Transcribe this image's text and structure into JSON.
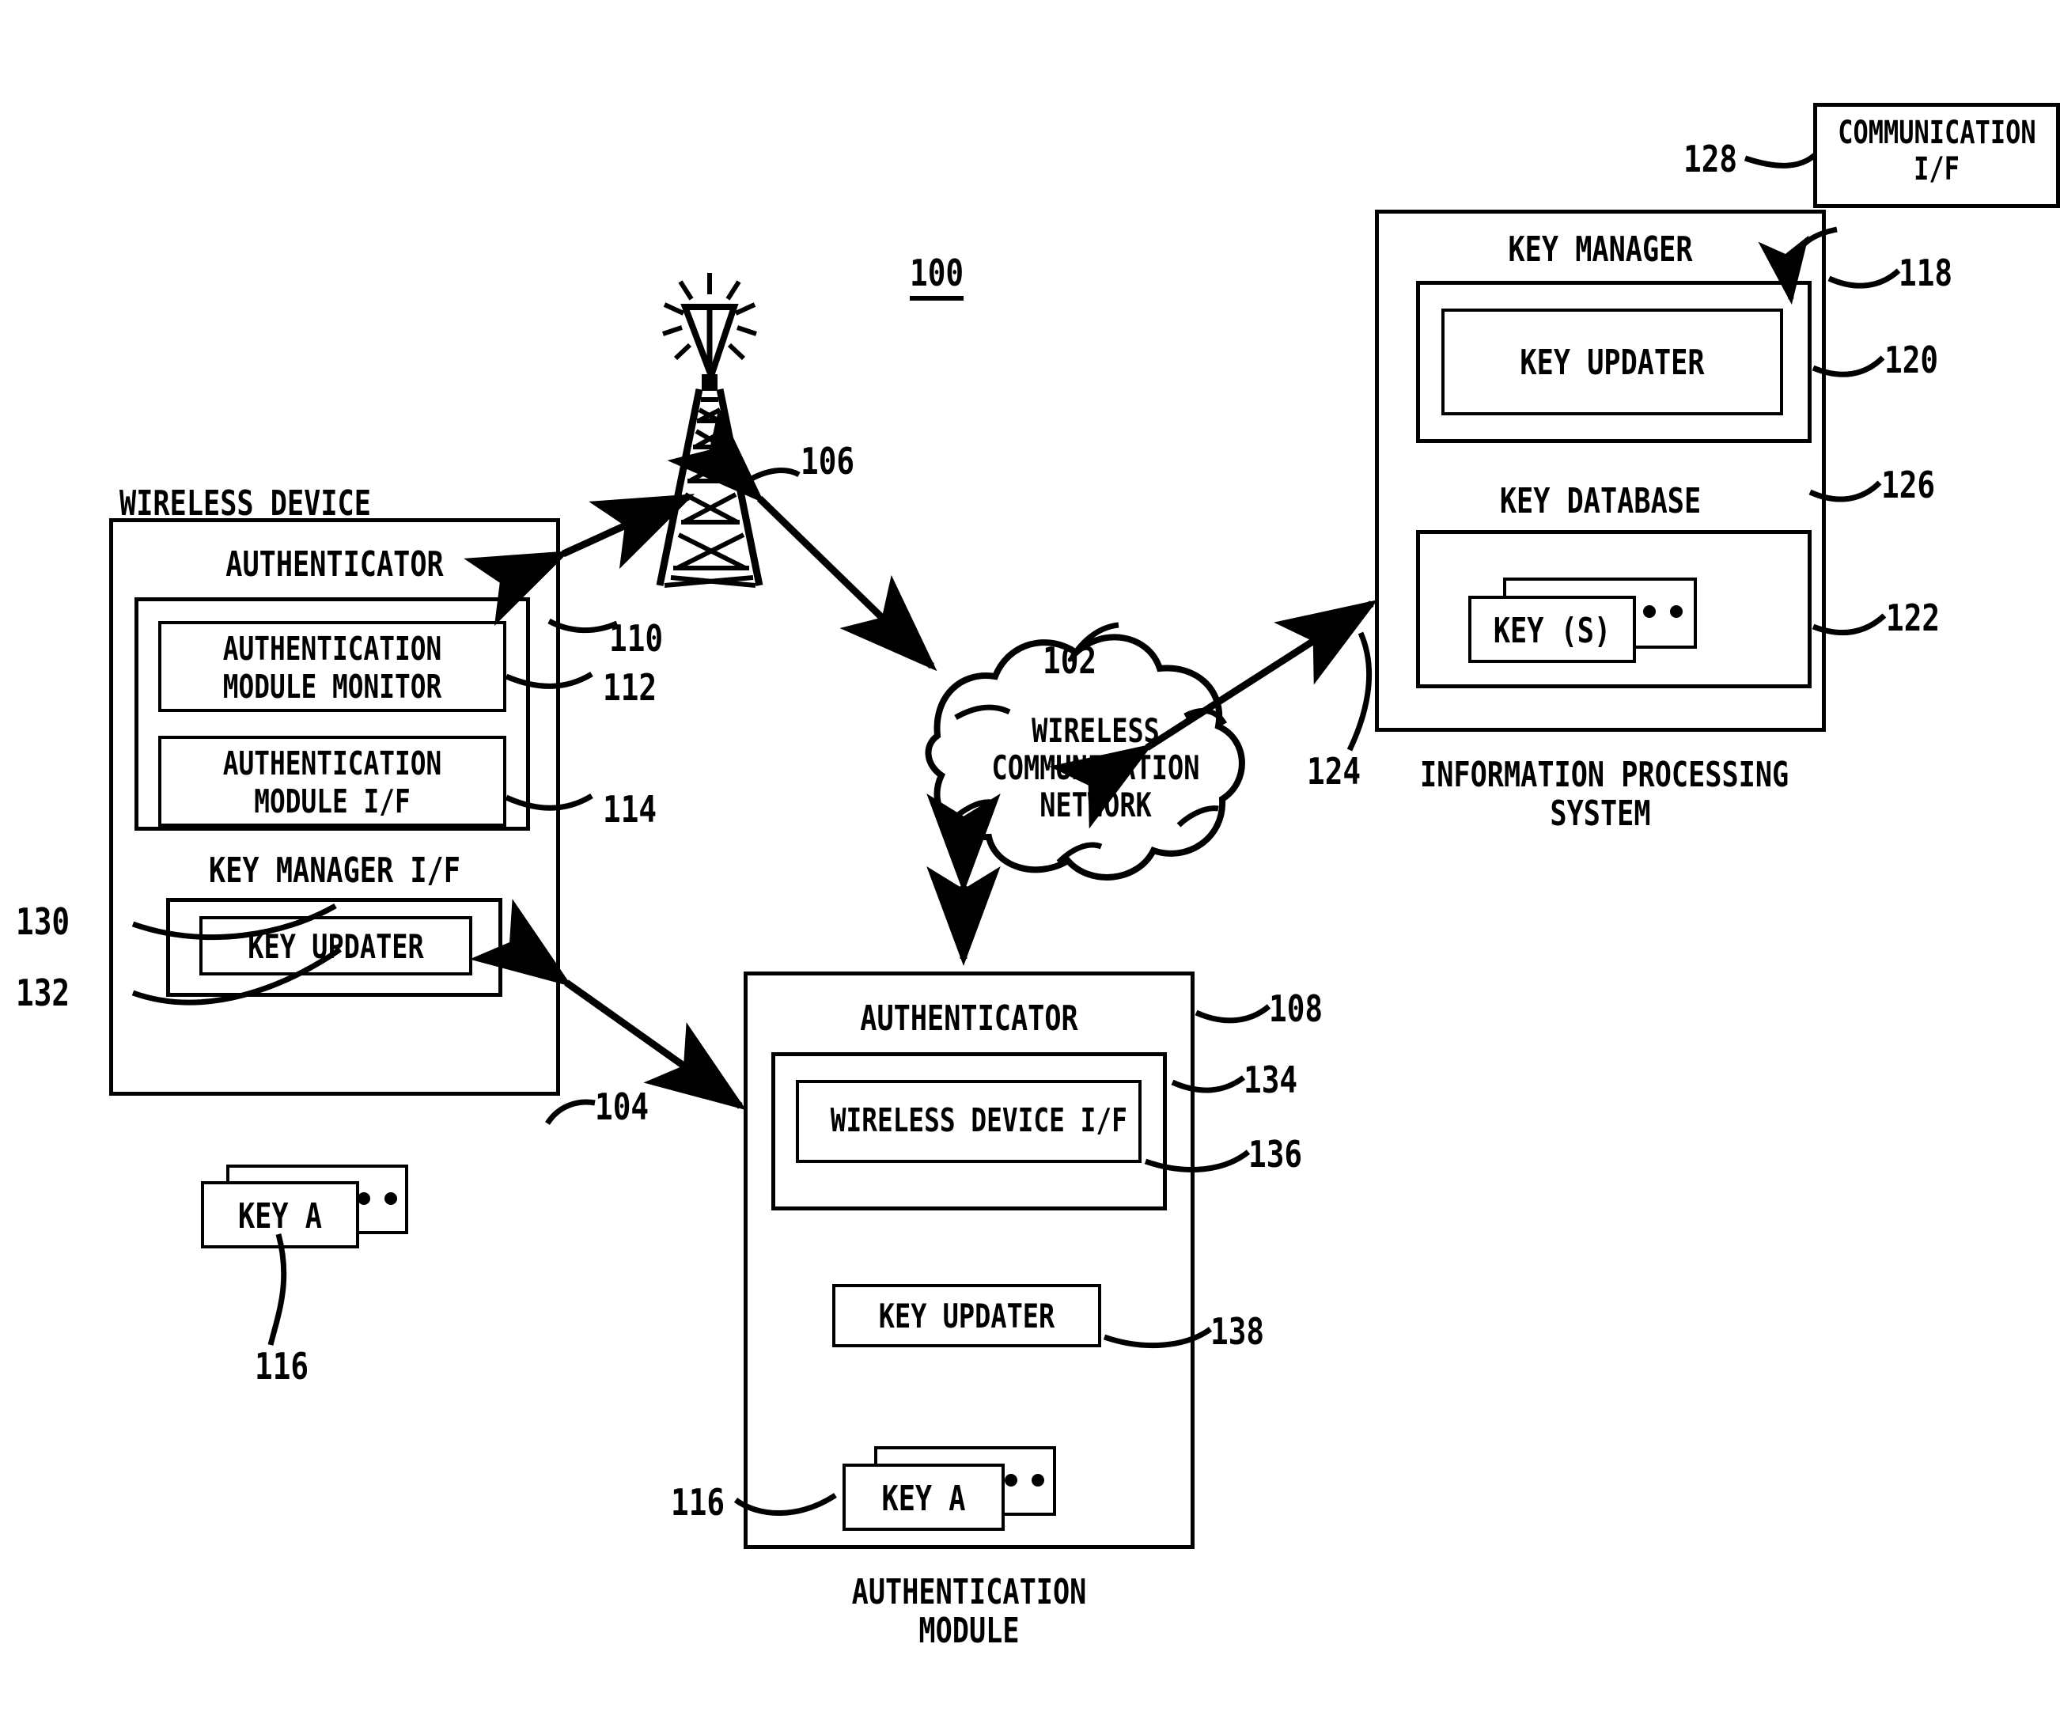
{
  "figure": {
    "number": "100"
  },
  "wireless_device": {
    "title": "WIRELESS DEVICE",
    "ref": "104",
    "authenticator": {
      "title": "AUTHENTICATOR",
      "ref": "110",
      "inner_ref": "112",
      "modules": [
        {
          "label": "AUTHENTICATION\nMODULE MONITOR",
          "ref": "112"
        },
        {
          "label": "AUTHENTICATION\nMODULE I/F",
          "ref": "114"
        }
      ]
    },
    "key_manager_if": {
      "title": "KEY MANAGER I/F",
      "ref": "130",
      "key_updater": {
        "label": "KEY UPDATER",
        "ref": "132"
      }
    },
    "keys": {
      "label": "KEY A",
      "ref": "116",
      "ellipsis": "• • •"
    }
  },
  "tower": {
    "ref": "106"
  },
  "network": {
    "label": "WIRELESS\nCOMMUNICATION\nNETWORK",
    "ref": "102"
  },
  "authentication_module": {
    "title": "AUTHENTICATION\nMODULE",
    "ref": "108",
    "authenticator": {
      "title": "AUTHENTICATOR",
      "ref": "134",
      "wireless_device_if": {
        "label": "WIRELESS DEVICE I/F",
        "ref": "136"
      }
    },
    "key_updater": {
      "label": "KEY UPDATER",
      "ref": "138"
    },
    "keys": {
      "label": "KEY A",
      "ref": "116",
      "ellipsis": "• • •"
    }
  },
  "information_processing_system": {
    "title": "INFORMATION PROCESSING\nSYSTEM",
    "ref": "118",
    "communication_if": {
      "label": "COMMUNICATION\nI/F",
      "ref": "128"
    },
    "key_manager": {
      "title": "KEY MANAGER",
      "ref": "120",
      "key_updater": {
        "label": "KEY UPDATER"
      }
    },
    "key_database": {
      "title": "KEY DATABASE",
      "ref": "126",
      "keys": {
        "label": "KEY (S)",
        "ref": "122",
        "ellipsis": "• • •"
      }
    },
    "arrow_ref": "124"
  },
  "colors": {
    "ink": "#000000",
    "paper": "#ffffff"
  }
}
